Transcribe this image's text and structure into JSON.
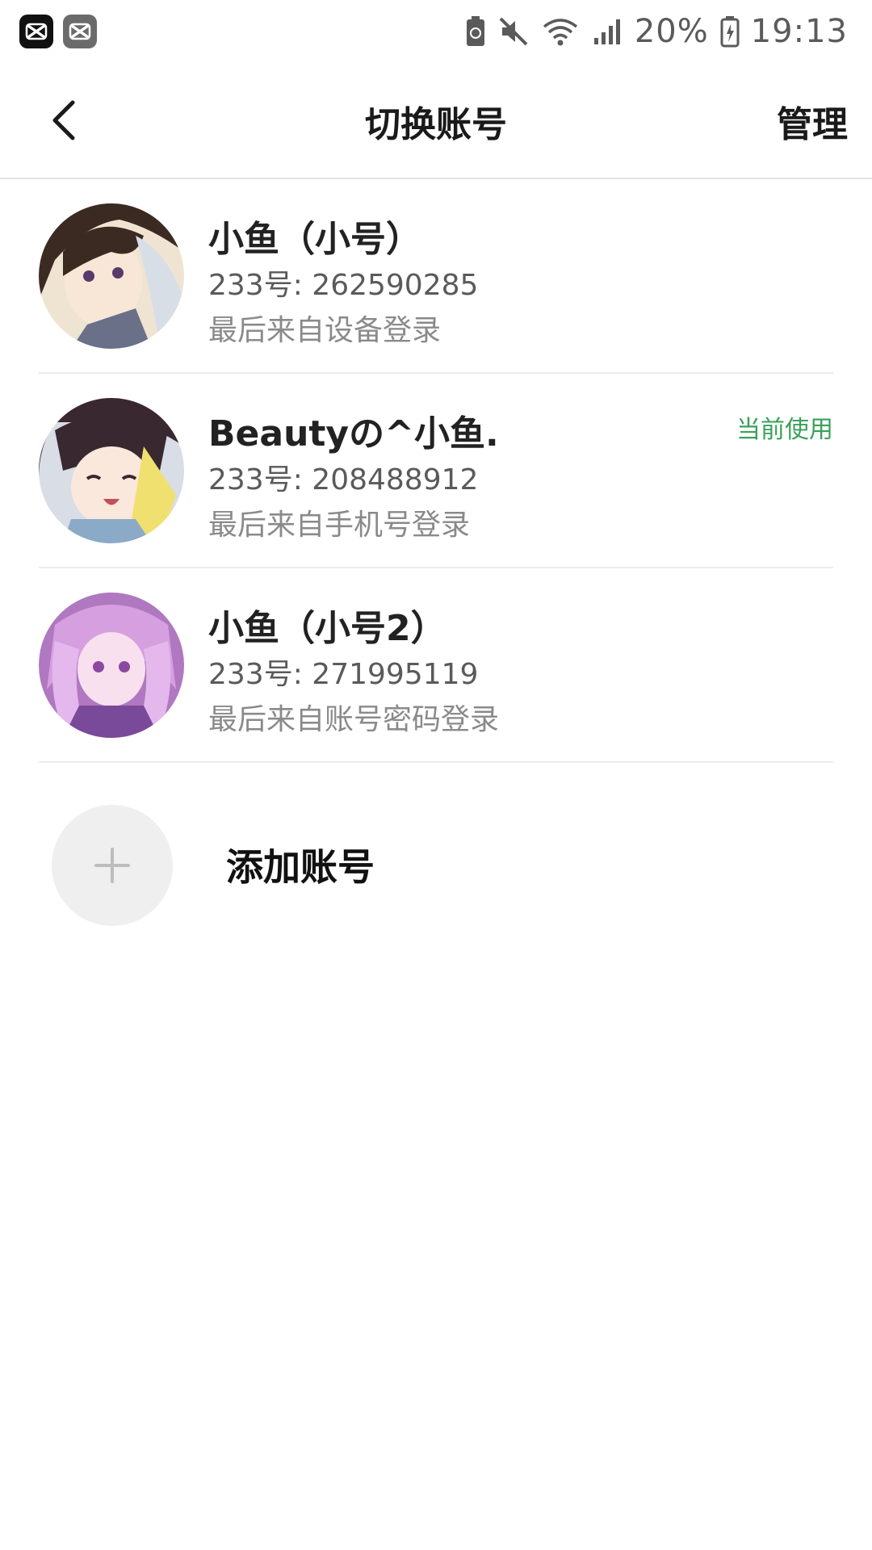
{
  "status_bar": {
    "battery_percent": "20%",
    "time": "19:13",
    "icons": [
      "capcut-icon",
      "capcut-icon",
      "battery-saver-icon",
      "mute-icon",
      "wifi-icon",
      "signal-icon",
      "battery-icon"
    ]
  },
  "header": {
    "title": "切换账号",
    "manage_label": "管理",
    "back_icon": "chevron-left-icon"
  },
  "accounts": [
    {
      "name": "小鱼（小号）",
      "id_text": "233号: 262590285",
      "login_text": "最后来自设备登录",
      "current_label": ""
    },
    {
      "name": "Beautyの^小鱼.",
      "id_text": "233号: 208488912",
      "login_text": "最后来自手机号登录",
      "current_label": "当前使用"
    },
    {
      "name": "小鱼（小号2）",
      "id_text": "233号: 271995119",
      "login_text": "最后来自账号密码登录",
      "current_label": ""
    }
  ],
  "add_account": {
    "label": "添加账号",
    "icon": "plus-icon"
  },
  "colors": {
    "accent_green": "#3aa05a",
    "divider": "#ebebeb",
    "text_primary": "#222222",
    "text_secondary": "#5a5a5a",
    "text_tertiary": "#8a8a8a"
  }
}
